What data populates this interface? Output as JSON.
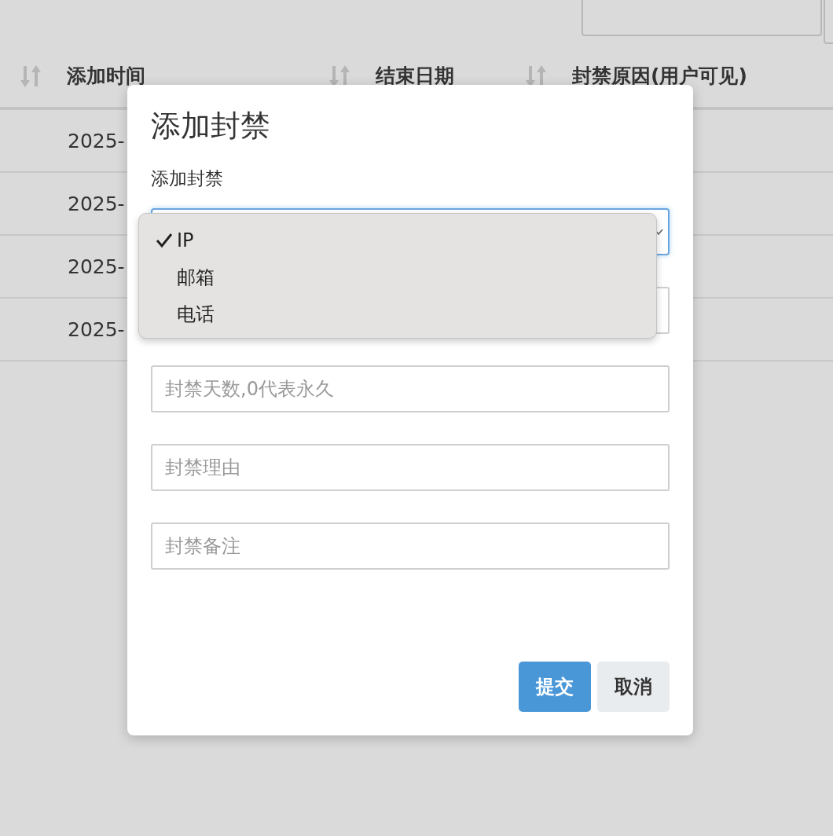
{
  "table": {
    "columns": [
      {
        "label": "添加时间"
      },
      {
        "label": "结束日期"
      },
      {
        "label": "封禁原因(用户可见)"
      }
    ],
    "rows": [
      {
        "column_1": "2025-"
      },
      {
        "column_1": "2025-"
      },
      {
        "column_1": "2025-"
      },
      {
        "column_1": "2025-"
      }
    ]
  },
  "dialog": {
    "title": "添加封禁",
    "label": "添加封禁",
    "select": {
      "expanded": true,
      "options": [
        {
          "label": "IP",
          "selected": true
        },
        {
          "label": "邮箱",
          "selected": false
        },
        {
          "label": "电话",
          "selected": false
        }
      ]
    },
    "fields": [
      {
        "placeholder": "封禁天数,0代表永久"
      },
      {
        "placeholder": "封禁理由"
      },
      {
        "placeholder": "封禁备注"
      }
    ],
    "buttons": [
      {
        "label": "提交",
        "kind": "primary"
      },
      {
        "label": "取消",
        "kind": "secondary"
      }
    ]
  }
}
